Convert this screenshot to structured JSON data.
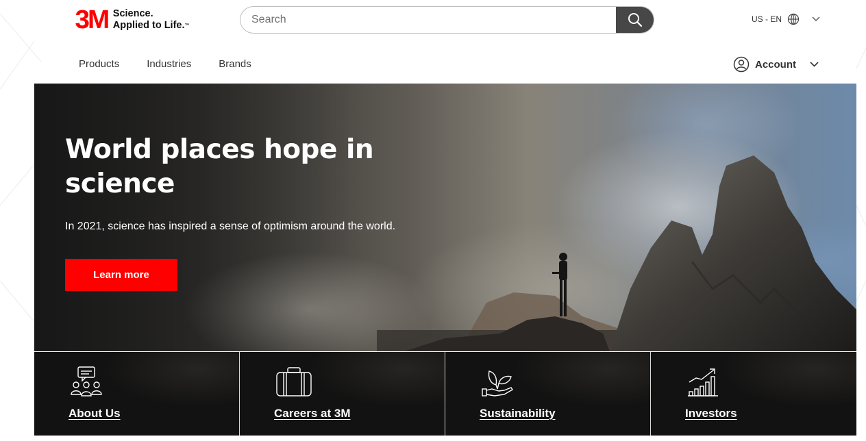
{
  "brand": {
    "logo_text": "3M",
    "tagline_line1": "Science.",
    "tagline_line2": "Applied to Life.",
    "trademark": "™",
    "accent_color": "#ff0000"
  },
  "search": {
    "placeholder": "Search",
    "value": "",
    "button_icon": "search-icon"
  },
  "locale": {
    "label": "US - EN",
    "icon": "globe-icon"
  },
  "nav": {
    "items": [
      {
        "label": "Products"
      },
      {
        "label": "Industries"
      },
      {
        "label": "Brands"
      }
    ]
  },
  "account": {
    "label": "Account",
    "icon": "user-circle-icon"
  },
  "hero": {
    "title": "World places hope in science",
    "subtitle": "In 2021, science has inspired a sense of optimism around the world.",
    "cta_label": "Learn more"
  },
  "tiles": [
    {
      "label": "About Us",
      "icon": "people-chat-icon"
    },
    {
      "label": "Careers at 3M",
      "icon": "briefcase-icon"
    },
    {
      "label": "Sustainability",
      "icon": "plant-hand-icon"
    },
    {
      "label": "Investors",
      "icon": "growth-chart-icon"
    }
  ]
}
